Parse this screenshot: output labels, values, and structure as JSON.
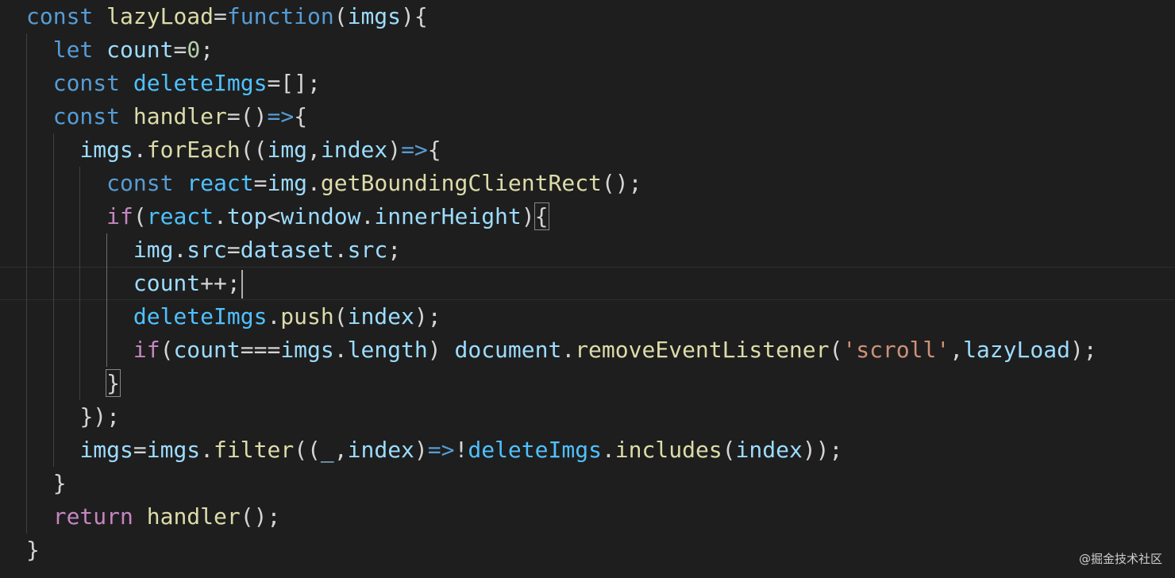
{
  "editor": {
    "theme_colors": {
      "background": "#1e1e1e",
      "keyword": "#569cd6",
      "control": "#c586c0",
      "function": "#dcdcaa",
      "variable": "#9cdcfe",
      "constant": "#4fc1ff",
      "number": "#b5cea8",
      "string": "#ce9178",
      "punctuation": "#d4d4d4"
    },
    "cursor_line": 9,
    "lines": [
      {
        "depth": 0,
        "tokens": [
          [
            "kw",
            "const"
          ],
          [
            "pun",
            " "
          ],
          [
            "fn",
            "lazyLoad"
          ],
          [
            "pun",
            "="
          ],
          [
            "kw",
            "function"
          ],
          [
            "pun",
            "("
          ],
          [
            "var",
            "imgs"
          ],
          [
            "pun",
            "){"
          ]
        ]
      },
      {
        "depth": 1,
        "tokens": [
          [
            "kw",
            "let"
          ],
          [
            "pun",
            " "
          ],
          [
            "var",
            "count"
          ],
          [
            "pun",
            "="
          ],
          [
            "num",
            "0"
          ],
          [
            "pun",
            ";"
          ]
        ]
      },
      {
        "depth": 1,
        "tokens": [
          [
            "kw",
            "const"
          ],
          [
            "pun",
            " "
          ],
          [
            "cst",
            "deleteImgs"
          ],
          [
            "pun",
            "=[];"
          ]
        ]
      },
      {
        "depth": 1,
        "tokens": [
          [
            "kw",
            "const"
          ],
          [
            "pun",
            " "
          ],
          [
            "fn",
            "handler"
          ],
          [
            "pun",
            "=()"
          ],
          [
            "kw",
            "=>"
          ],
          [
            "pun",
            "{"
          ]
        ]
      },
      {
        "depth": 2,
        "tokens": [
          [
            "var",
            "imgs"
          ],
          [
            "pun",
            "."
          ],
          [
            "fn",
            "forEach"
          ],
          [
            "pun",
            "(("
          ],
          [
            "var",
            "img"
          ],
          [
            "pun",
            ","
          ],
          [
            "var",
            "index"
          ],
          [
            "pun",
            ")"
          ],
          [
            "kw",
            "=>"
          ],
          [
            "pun",
            "{"
          ]
        ]
      },
      {
        "depth": 3,
        "tokens": [
          [
            "kw",
            "const"
          ],
          [
            "pun",
            " "
          ],
          [
            "cst",
            "react"
          ],
          [
            "pun",
            "="
          ],
          [
            "var",
            "img"
          ],
          [
            "pun",
            "."
          ],
          [
            "fn",
            "getBoundingClientRect"
          ],
          [
            "pun",
            "();"
          ]
        ]
      },
      {
        "depth": 3,
        "tokens": [
          [
            "ctl",
            "if"
          ],
          [
            "pun",
            "("
          ],
          [
            "cst",
            "react"
          ],
          [
            "pun",
            "."
          ],
          [
            "var",
            "top"
          ],
          [
            "pun",
            "<"
          ],
          [
            "var",
            "window"
          ],
          [
            "pun",
            "."
          ],
          [
            "var",
            "innerHeight"
          ],
          [
            "pun",
            ")"
          ],
          [
            "box",
            "{"
          ]
        ]
      },
      {
        "depth": 4,
        "tokens": [
          [
            "var",
            "img"
          ],
          [
            "pun",
            "."
          ],
          [
            "var",
            "src"
          ],
          [
            "pun",
            "="
          ],
          [
            "var",
            "dataset"
          ],
          [
            "pun",
            "."
          ],
          [
            "var",
            "src"
          ],
          [
            "pun",
            ";"
          ]
        ]
      },
      {
        "depth": 4,
        "tokens": [
          [
            "var",
            "count"
          ],
          [
            "pun",
            "++;"
          ]
        ]
      },
      {
        "depth": 4,
        "tokens": [
          [
            "cst",
            "deleteImgs"
          ],
          [
            "pun",
            "."
          ],
          [
            "fn",
            "push"
          ],
          [
            "pun",
            "("
          ],
          [
            "var",
            "index"
          ],
          [
            "pun",
            ");"
          ]
        ]
      },
      {
        "depth": 4,
        "tokens": [
          [
            "ctl",
            "if"
          ],
          [
            "pun",
            "("
          ],
          [
            "var",
            "count"
          ],
          [
            "pun",
            "==="
          ],
          [
            "var",
            "imgs"
          ],
          [
            "pun",
            "."
          ],
          [
            "var",
            "length"
          ],
          [
            "pun",
            ") "
          ],
          [
            "var",
            "document"
          ],
          [
            "pun",
            "."
          ],
          [
            "fn",
            "removeEventListener"
          ],
          [
            "pun",
            "("
          ],
          [
            "str",
            "'scroll'"
          ],
          [
            "pun",
            ","
          ],
          [
            "var",
            "lazyLoad"
          ],
          [
            "pun",
            ");"
          ]
        ]
      },
      {
        "depth": 3,
        "tokens": [
          [
            "box",
            "}"
          ]
        ]
      },
      {
        "depth": 2,
        "tokens": [
          [
            "pun",
            "});"
          ]
        ]
      },
      {
        "depth": 2,
        "tokens": [
          [
            "var",
            "imgs"
          ],
          [
            "pun",
            "="
          ],
          [
            "var",
            "imgs"
          ],
          [
            "pun",
            "."
          ],
          [
            "fn",
            "filter"
          ],
          [
            "pun",
            "(("
          ],
          [
            "var",
            "_"
          ],
          [
            "pun",
            ","
          ],
          [
            "var",
            "index"
          ],
          [
            "pun",
            ")"
          ],
          [
            "kw",
            "=>"
          ],
          [
            "pun",
            "!"
          ],
          [
            "cst",
            "deleteImgs"
          ],
          [
            "pun",
            "."
          ],
          [
            "fn",
            "includes"
          ],
          [
            "pun",
            "("
          ],
          [
            "var",
            "index"
          ],
          [
            "pun",
            "));"
          ]
        ]
      },
      {
        "depth": 1,
        "tokens": [
          [
            "pun",
            "}"
          ]
        ]
      },
      {
        "depth": 1,
        "tokens": [
          [
            "ctl",
            "return"
          ],
          [
            "pun",
            " "
          ],
          [
            "fn",
            "handler"
          ],
          [
            "pun",
            "();"
          ]
        ]
      },
      {
        "depth": 0,
        "tokens": [
          [
            "pun",
            "}"
          ]
        ]
      }
    ]
  },
  "watermark": "@掘金技术社区"
}
